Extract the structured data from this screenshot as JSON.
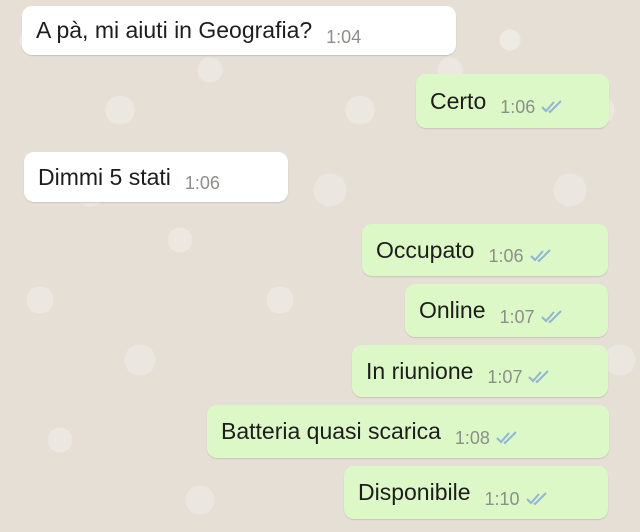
{
  "conversation": {
    "messages": [
      {
        "direction": "incoming",
        "text": "A pà, mi aiuti in Geografia?",
        "time": "1:04"
      },
      {
        "direction": "outgoing",
        "text": "Certo",
        "time": "1:06",
        "status": "double-check-icon"
      },
      {
        "direction": "incoming",
        "text": "Dimmi 5 stati",
        "time": "1:06"
      },
      {
        "direction": "outgoing",
        "text": "Occupato",
        "time": "1:06",
        "status": "double-check-icon"
      },
      {
        "direction": "outgoing",
        "text": "Online",
        "time": "1:07",
        "status": "double-check-icon"
      },
      {
        "direction": "outgoing",
        "text": "In riunione",
        "time": "1:07",
        "status": "double-check-icon"
      },
      {
        "direction": "outgoing",
        "text": "Batteria quasi scarica",
        "time": "1:08",
        "status": "double-check-icon"
      },
      {
        "direction": "outgoing",
        "text": "Disponibile",
        "time": "1:10",
        "status": "double-check-icon"
      }
    ]
  },
  "colors": {
    "incoming_bubble": "#ffffff",
    "outgoing_bubble": "#dcf8c6",
    "chat_background": "#e5dfd6",
    "read_ticks": "#8fb5d8"
  }
}
